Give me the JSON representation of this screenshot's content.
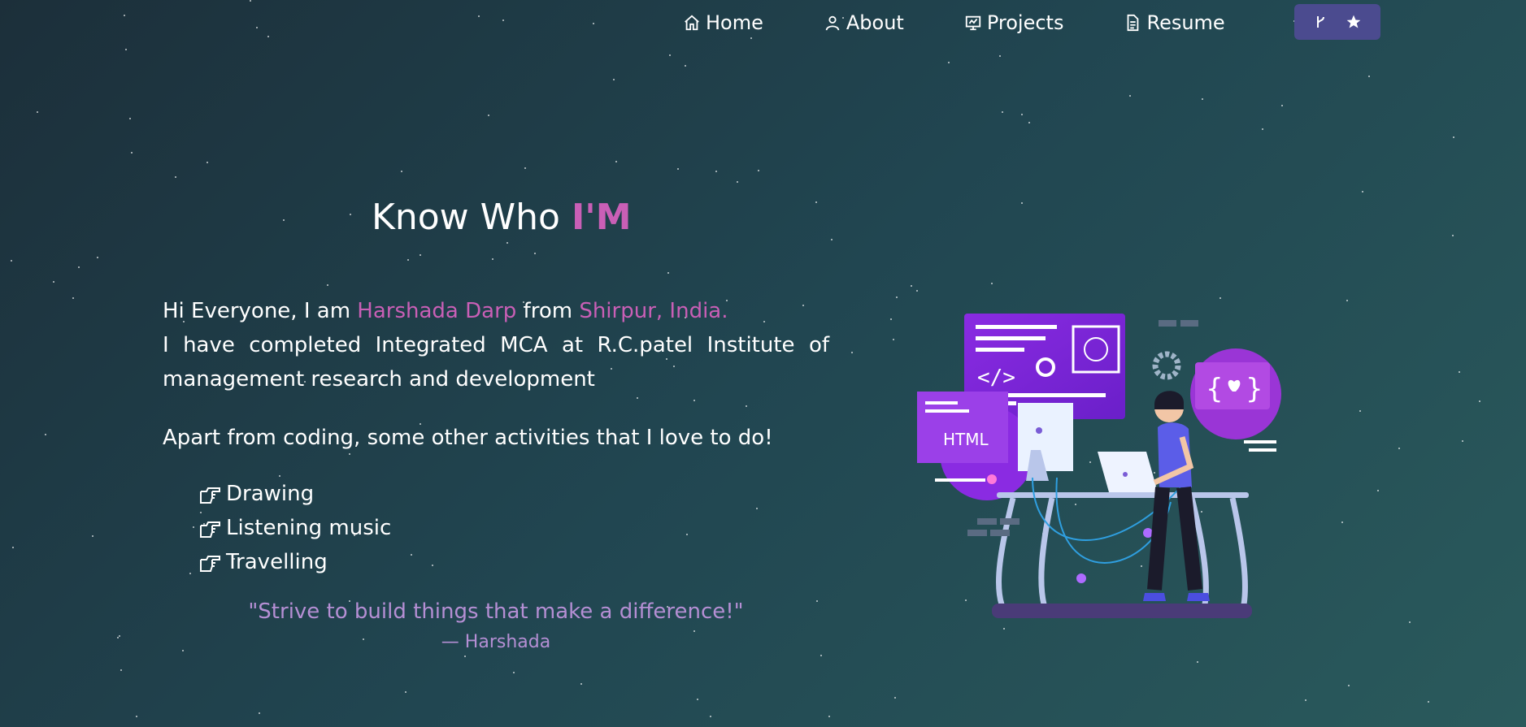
{
  "nav": {
    "items": [
      {
        "label": "Home",
        "icon": "home-icon"
      },
      {
        "label": "About",
        "icon": "user-icon"
      },
      {
        "label": "Projects",
        "icon": "projects-icon"
      },
      {
        "label": "Resume",
        "icon": "document-icon"
      }
    ],
    "github_button": {
      "icons": [
        "git-fork-icon",
        "star-icon"
      ]
    }
  },
  "heading": {
    "text": "Know Who ",
    "highlight": "I'M"
  },
  "intro": {
    "line1_prefix": "Hi Everyone, I am ",
    "name": "Harshada Darp",
    "line1_mid": " from ",
    "location": "Shirpur, India.",
    "line2": "I have completed Integrated MCA at R.C.patel Institute of management research and development"
  },
  "activities": {
    "intro": "Apart from coding, some other activities that I love to do!",
    "items": [
      "Drawing",
      "Listening music",
      "Travelling"
    ]
  },
  "quote": {
    "text": "\"Strive to build things that make a difference!\"",
    "author": "— Harshada"
  },
  "illustration": {
    "label": "HTML"
  },
  "colors": {
    "accent": "#c95fb6",
    "quote": "#b58fd4",
    "button": "#4b4b8f"
  }
}
